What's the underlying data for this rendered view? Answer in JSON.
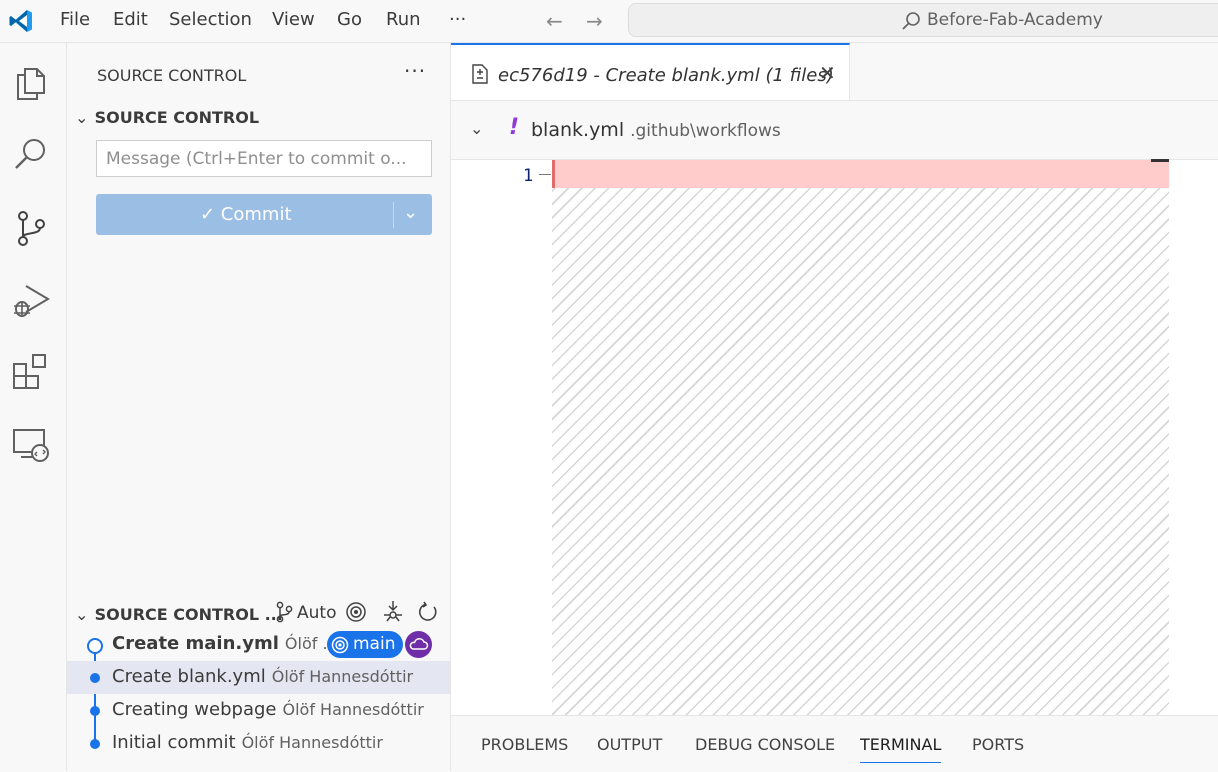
{
  "titlebar": {
    "menu": [
      "File",
      "Edit",
      "Selection",
      "View",
      "Go",
      "Run"
    ],
    "more": "···",
    "search_text": "Before-Fab-Academy"
  },
  "activity_icons": [
    "explorer-icon",
    "search-icon",
    "source-control-icon",
    "run-debug-icon",
    "extensions-icon",
    "remote-explorer-icon"
  ],
  "sidebar": {
    "title": "SOURCE CONTROL",
    "more": "···",
    "section_title": "SOURCE CONTROL",
    "message_placeholder": "Message (Ctrl+Enter to commit o...",
    "commit_label": "✓ Commit",
    "graph": {
      "title": "SOURCE CONTROL ...",
      "auto_label": "Auto",
      "commits": [
        {
          "message": "Create main.yml",
          "author": "Ólöf ...",
          "branch": "main"
        },
        {
          "message": "Create blank.yml",
          "author": "Ólöf Hannesdóttir"
        },
        {
          "message": "Creating webpage",
          "author": "Ólöf Hannesdóttir"
        },
        {
          "message": "Initial commit",
          "author": "Ólöf Hannesdóttir"
        }
      ]
    }
  },
  "editor": {
    "tab_title": "ec576d19 - Create blank.yml (1 files)",
    "file_marker": "!",
    "file_name": "blank.yml",
    "file_path": ".github\\workflows",
    "line_number": "1"
  },
  "panel_tabs": [
    "PROBLEMS",
    "OUTPUT",
    "DEBUG CONSOLE",
    "TERMINAL",
    "PORTS"
  ],
  "colors": {
    "accent": "#1a73e8",
    "removed_line": "#ffcccb",
    "commit_button": "#9bbee4",
    "cloud_badge": "#6f2da8"
  }
}
